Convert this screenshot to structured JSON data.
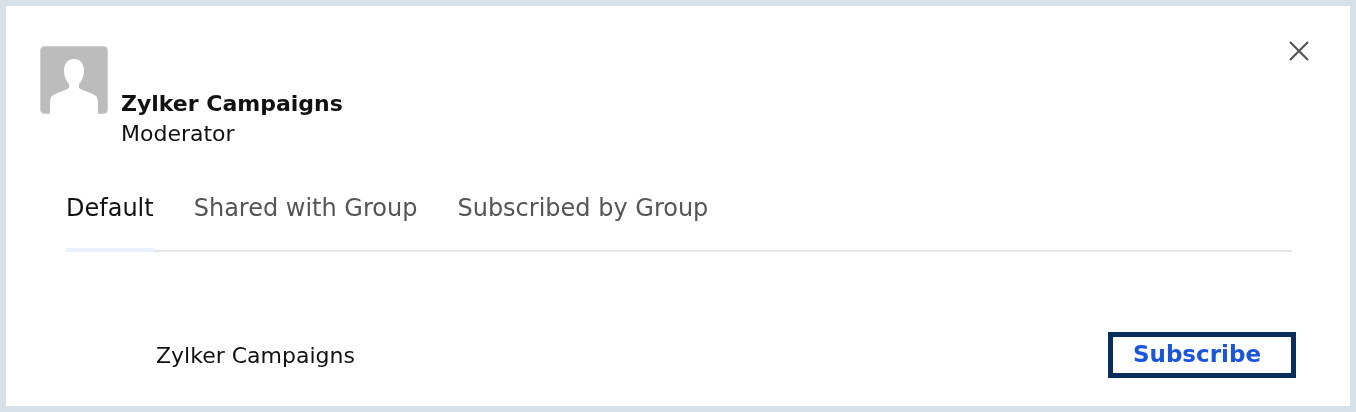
{
  "profile": {
    "name": "Zylker Campaigns",
    "role": "Moderator"
  },
  "tabs": [
    {
      "label": "Default",
      "selected": true
    },
    {
      "label": "Shared with Group",
      "selected": false
    },
    {
      "label": "Subscribed by Group",
      "selected": false
    }
  ],
  "rows": [
    {
      "name": "Zylker Campaigns",
      "action": "Subscribe"
    }
  ]
}
